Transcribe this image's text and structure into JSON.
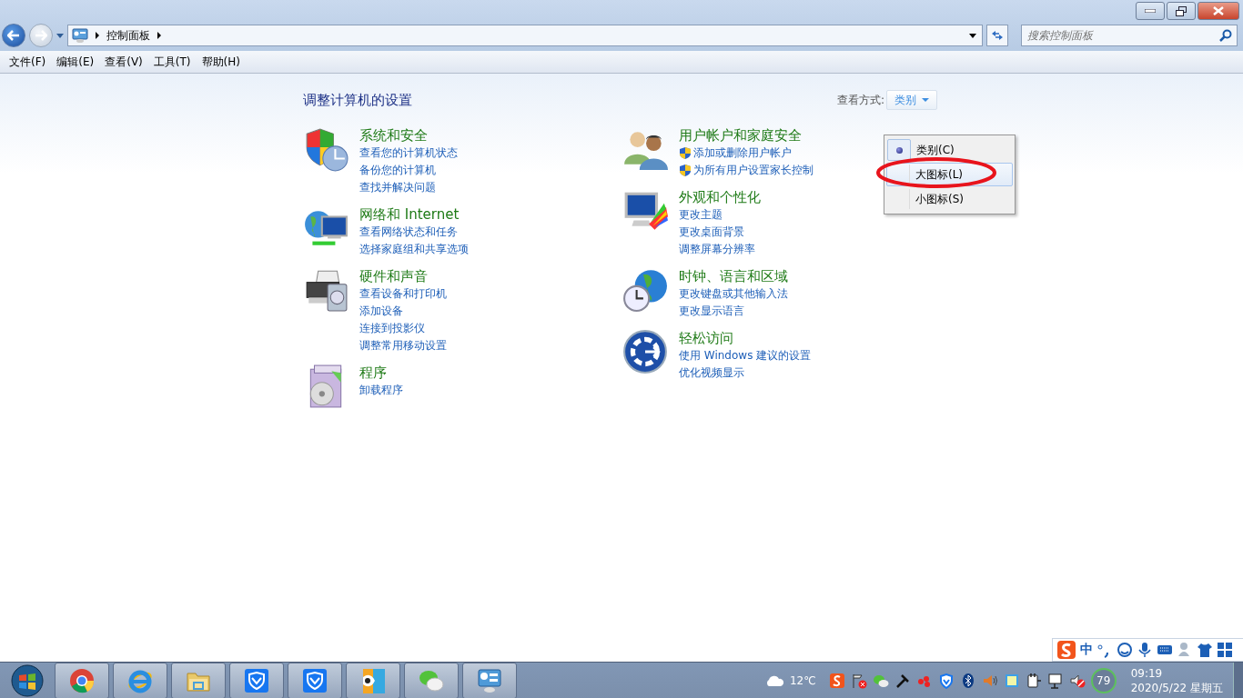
{
  "address_bar": {
    "path": [
      "控制面板"
    ]
  },
  "search": {
    "placeholder": "搜索控制面板"
  },
  "menu": [
    "文件(F)",
    "编辑(E)",
    "查看(V)",
    "工具(T)",
    "帮助(H)"
  ],
  "heading": "调整计算机的设置",
  "view_by": {
    "label": "查看方式:",
    "value": "类别",
    "options": [
      {
        "label": "类别(C)",
        "selected": true,
        "hovered": false
      },
      {
        "label": "大图标(L)",
        "selected": false,
        "hovered": true
      },
      {
        "label": "小图标(S)",
        "selected": false,
        "hovered": false
      }
    ]
  },
  "columns": [
    {
      "categories": [
        {
          "kind": "security",
          "title": "系统和安全",
          "links": [
            {
              "text": "查看您的计算机状态",
              "shield": false
            },
            {
              "text": "备份您的计算机",
              "shield": false
            },
            {
              "text": "查找并解决问题",
              "shield": false
            }
          ]
        },
        {
          "kind": "network",
          "title": "网络和 Internet",
          "links": [
            {
              "text": "查看网络状态和任务",
              "shield": false
            },
            {
              "text": "选择家庭组和共享选项",
              "shield": false
            }
          ]
        },
        {
          "kind": "hardware",
          "title": "硬件和声音",
          "links": [
            {
              "text": "查看设备和打印机",
              "shield": false
            },
            {
              "text": "添加设备",
              "shield": false
            },
            {
              "text": "连接到投影仪",
              "shield": false
            },
            {
              "text": "调整常用移动设置",
              "shield": false
            }
          ]
        },
        {
          "kind": "programs",
          "title": "程序",
          "links": [
            {
              "text": "卸载程序",
              "shield": false
            }
          ]
        }
      ]
    },
    {
      "categories": [
        {
          "kind": "users",
          "title": "用户帐户和家庭安全",
          "links": [
            {
              "text": "添加或删除用户帐户",
              "shield": true
            },
            {
              "text": "为所有用户设置家长控制",
              "shield": true
            }
          ]
        },
        {
          "kind": "appearance",
          "title": "外观和个性化",
          "links": [
            {
              "text": "更改主题",
              "shield": false
            },
            {
              "text": "更改桌面背景",
              "shield": false
            },
            {
              "text": "调整屏幕分辨率",
              "shield": false
            }
          ]
        },
        {
          "kind": "clock",
          "title": "时钟、语言和区域",
          "links": [
            {
              "text": "更改键盘或其他输入法",
              "shield": false
            },
            {
              "text": "更改显示语言",
              "shield": false
            }
          ]
        },
        {
          "kind": "ease",
          "title": "轻松访问",
          "links": [
            {
              "text": "使用 Windows 建议的设置",
              "shield": false
            },
            {
              "text": "优化视频显示",
              "shield": false
            }
          ]
        }
      ]
    }
  ],
  "ime_bar": {
    "mode": "中"
  },
  "taskbar": {
    "apps": [
      {
        "kind": "chrome"
      },
      {
        "kind": "ie"
      },
      {
        "kind": "folder"
      },
      {
        "kind": "shield"
      },
      {
        "kind": "shield"
      },
      {
        "kind": "pdf"
      },
      {
        "kind": "chat"
      },
      {
        "kind": "panel"
      }
    ]
  },
  "tray": {
    "temperature": "12℃",
    "meter": "79",
    "time": "09:19",
    "date": "2020/5/22 星期五"
  }
}
